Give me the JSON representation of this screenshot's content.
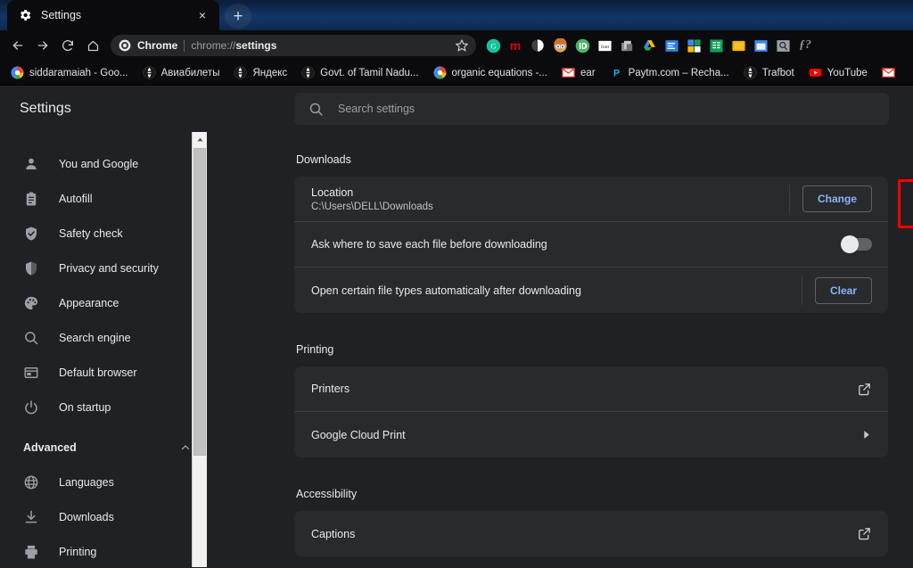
{
  "window": {
    "tab": {
      "title": "Settings",
      "favicon": "gear-icon",
      "close_label": "×"
    },
    "new_tab_label": "+"
  },
  "toolbar": {
    "back_label": "Back",
    "forward_label": "Forward",
    "reload_label": "Reload",
    "home_label": "Home",
    "omnibox": {
      "chip_label": "Chrome",
      "url_prefix": "chrome://",
      "url_bold": "settings",
      "bookmark_star": "star-icon"
    },
    "extensions": [
      {
        "name": "grammarly-extension-icon",
        "glyph": "G",
        "bg": "#15c39a",
        "fg": "#ffffff",
        "shape": "circle"
      },
      {
        "name": "mega-extension-icon",
        "glyph": "m",
        "bg": "transparent",
        "fg": "#d9001b",
        "shape": "text"
      },
      {
        "name": "dark-reader-extension-icon",
        "glyph": "◐",
        "bg": "transparent",
        "fg": "#ffffff",
        "shape": "halfcircle"
      },
      {
        "name": "character-avatar-extension-icon",
        "glyph": "●",
        "bg": "#d8a25e",
        "fg": "#2b6fd6",
        "shape": "face"
      },
      {
        "name": "pushbullet-extension-icon",
        "glyph": "ID",
        "bg": "#4ab367",
        "fg": "#ffffff",
        "shape": "circle"
      },
      {
        "name": "font-finder-extension-icon",
        "glyph": "font",
        "bg": "#ffffff",
        "fg": "#2b2b2b",
        "shape": "square"
      },
      {
        "name": "copy-all-urls-extension-icon",
        "glyph": "❐",
        "bg": "transparent",
        "fg": "#bfc2c6",
        "shape": "pages"
      },
      {
        "name": "google-drive-extension-icon",
        "glyph": "▲",
        "bg": "transparent",
        "fg": "#f4b400",
        "shape": "drive"
      },
      {
        "name": "google-keep-extension-icon",
        "glyph": "≡",
        "bg": "#2b7de9",
        "fg": "#ffffff",
        "shape": "square"
      },
      {
        "name": "office-extension-icon",
        "glyph": "⊞",
        "bg": "transparent",
        "fg": "#f4b400",
        "shape": "quad"
      },
      {
        "name": "google-sheets-extension-icon",
        "glyph": "▦",
        "bg": "#0f9d58",
        "fg": "#ffffff",
        "shape": "square"
      },
      {
        "name": "sticky-notes-extension-icon",
        "glyph": "■",
        "bg": "#f4b400",
        "fg": "#ffffff",
        "shape": "square"
      },
      {
        "name": "screen-capture-extension-icon",
        "glyph": "▣",
        "bg": "#4285f4",
        "fg": "#ffffff",
        "shape": "square"
      },
      {
        "name": "search-tool-extension-icon",
        "glyph": "⚲",
        "bg": "#9aa0a6",
        "fg": "#2b2b2b",
        "shape": "square"
      },
      {
        "name": "equation-extension-icon",
        "glyph": "ƒ?",
        "bg": "transparent",
        "fg": "#8a8d91",
        "shape": "text"
      }
    ]
  },
  "bookmarks": [
    {
      "label": "siddaramaiah - Goo...",
      "icon": "google-icon"
    },
    {
      "label": "Авиабилеты",
      "icon": "globe-icon"
    },
    {
      "label": "Яндекс",
      "icon": "globe-icon"
    },
    {
      "label": "Govt. of Tamil Nadu...",
      "icon": "globe-icon"
    },
    {
      "label": "organic equations -...",
      "icon": "google-icon"
    },
    {
      "label": "ear",
      "icon": "gmail-icon"
    },
    {
      "label": "Paytm.com – Recha...",
      "icon": "paytm-icon"
    },
    {
      "label": "Trafbot",
      "icon": "globe-icon"
    },
    {
      "label": "YouTube",
      "icon": "youtube-icon"
    },
    {
      "label": "",
      "icon": "gmail-icon"
    }
  ],
  "settings": {
    "header_title": "Settings",
    "search": {
      "placeholder": "Search settings",
      "value": "",
      "icon": "search-icon"
    },
    "sidebar": {
      "items": [
        {
          "label": "You and Google",
          "icon": "person-icon"
        },
        {
          "label": "Autofill",
          "icon": "clipboard-icon"
        },
        {
          "label": "Safety check",
          "icon": "shield-check-icon"
        },
        {
          "label": "Privacy and security",
          "icon": "shield-icon"
        },
        {
          "label": "Appearance",
          "icon": "palette-icon"
        },
        {
          "label": "Search engine",
          "icon": "magnifier-icon"
        },
        {
          "label": "Default browser",
          "icon": "browser-window-icon"
        },
        {
          "label": "On startup",
          "icon": "power-icon"
        }
      ],
      "advanced": {
        "label": "Advanced",
        "expanded": true,
        "arrow_icon": "chevron-up-icon",
        "items": [
          {
            "label": "Languages",
            "icon": "globe-icon"
          },
          {
            "label": "Downloads",
            "icon": "download-icon"
          },
          {
            "label": "Printing",
            "icon": "printer-icon"
          }
        ]
      }
    },
    "sections": [
      {
        "title": "Downloads",
        "rows": [
          {
            "name": "downloads-location-row",
            "label": "Location",
            "sublabel": "C:\\Users\\DELL\\Downloads",
            "control": "button",
            "button_label": "Change",
            "highlighted": true
          },
          {
            "name": "ask-where-to-save-row",
            "label": "Ask where to save each file before downloading",
            "sublabel": "",
            "control": "toggle",
            "toggle_on": false
          },
          {
            "name": "open-file-types-row",
            "label": "Open certain file types automatically after downloading",
            "sublabel": "",
            "control": "button",
            "button_label": "Clear"
          }
        ]
      },
      {
        "title": "Printing",
        "rows": [
          {
            "name": "printers-row",
            "label": "Printers",
            "sublabel": "",
            "control": "external-link",
            "icon": "external-link-icon"
          },
          {
            "name": "google-cloud-print-row",
            "label": "Google Cloud Print",
            "sublabel": "",
            "control": "chevron",
            "icon": "chevron-right-icon"
          }
        ]
      },
      {
        "title": "Accessibility",
        "rows": [
          {
            "name": "captions-row",
            "label": "Captions",
            "sublabel": "",
            "control": "external-link",
            "icon": "external-link-icon"
          }
        ]
      }
    ]
  },
  "colors": {
    "accent_blue": "#8ab4f8",
    "annotation_red": "#fe0000",
    "surface": "#292a2d",
    "background": "#202124"
  }
}
